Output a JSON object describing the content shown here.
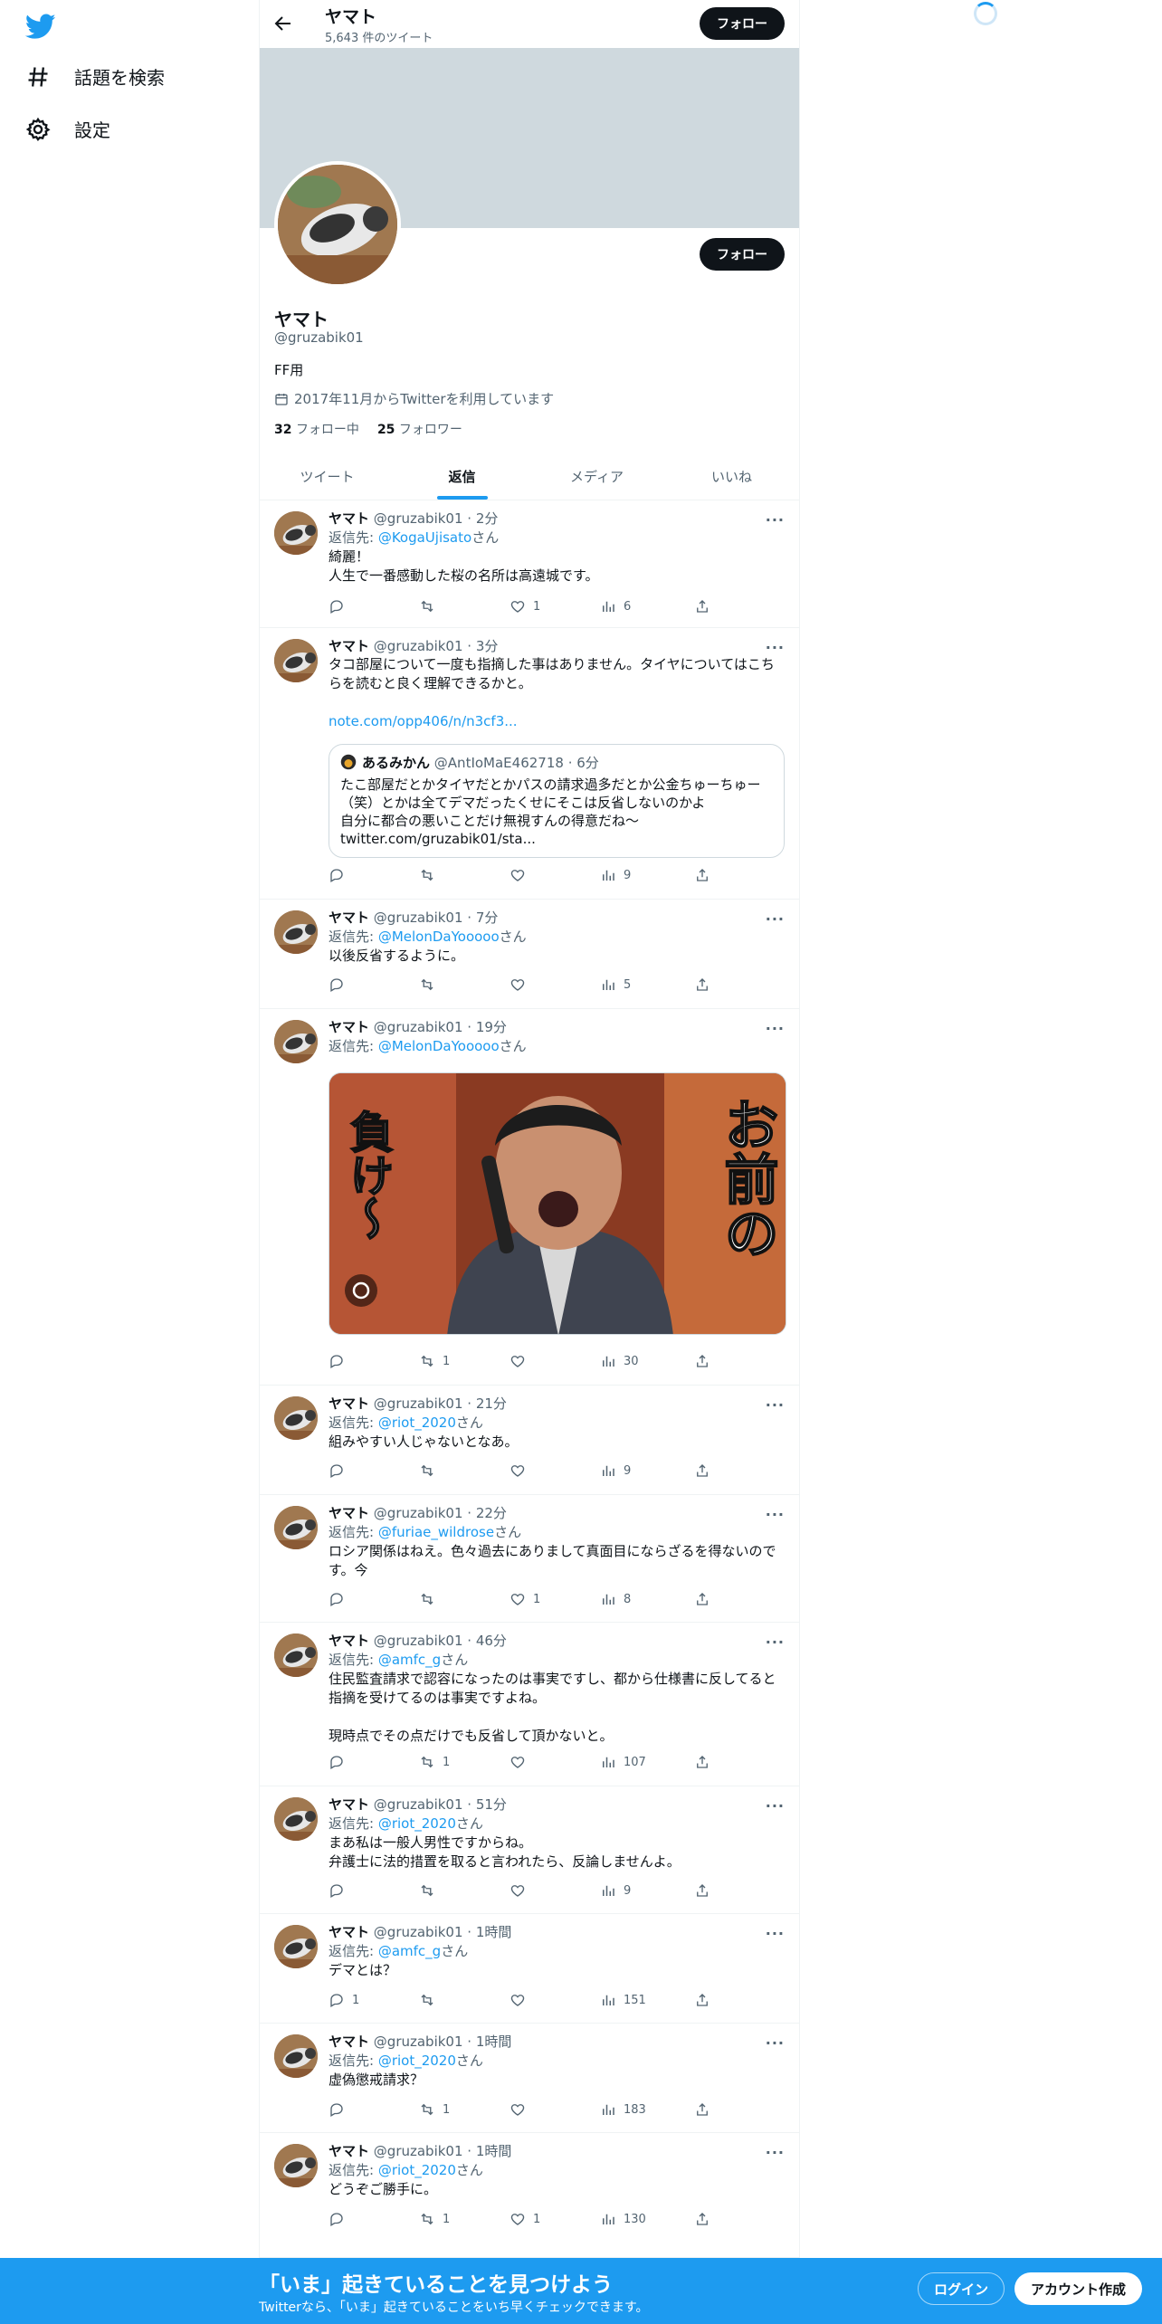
{
  "nav": {
    "explore_label": "話題を検索",
    "settings_label": "設定"
  },
  "header": {
    "name": "ヤマト",
    "tweet_count": "5,643 件のツイート",
    "follow_label": "フォロー"
  },
  "profile": {
    "name": "ヤマト",
    "handle": "@gruzabik01",
    "bio": "FF用",
    "joined": "2017年11月からTwitterを利用しています",
    "following_count": "32",
    "following_label": "フォロー中",
    "followers_count": "25",
    "followers_label": "フォロワー",
    "follow_label": "フォロー"
  },
  "tabs": [
    "ツイート",
    "返信",
    "メディア",
    "いいね"
  ],
  "reply_prefix": "返信先: ",
  "reply_suffix": "さん",
  "tweets": [
    {
      "name": "ヤマト",
      "meta": "@gruzabik01 · 2分",
      "reply_to": "@KogaUjisato",
      "text": "綺麗！\n人生で一番感動した桜の名所は高遠城です。",
      "replies": "",
      "retweets": "",
      "likes": "1",
      "views": "6"
    },
    {
      "name": "ヤマト",
      "meta": "@gruzabik01 · 3分",
      "text": "タコ部屋について一度も指摘した事はありません。タイヤについてはこちらを読むと良く理解できるかと。",
      "link": "note.com/opp406/n/n3cf3...",
      "quote": {
        "name": "あるみかん",
        "meta": "@AntIoMaE462718 · 6分",
        "text": "たこ部屋だとかタイヤだとかパスの請求過多だとか公金ちゅーちゅー（笑）とかは全てデマだったくせにそこは反省しないのかよ\n自分に都合の悪いことだけ無視すんの得意だね〜\ntwitter.com/gruzabik01/sta..."
      },
      "replies": "",
      "retweets": "",
      "likes": "",
      "views": "9"
    },
    {
      "name": "ヤマト",
      "meta": "@gruzabik01 · 7分",
      "reply_to": "@MelonDaYooooo",
      "text": "以後反省するように。",
      "replies": "",
      "retweets": "",
      "likes": "",
      "views": "5"
    },
    {
      "name": "ヤマト",
      "meta": "@gruzabik01 · 19分",
      "reply_to": "@MelonDaYooooo",
      "media_text_left": "負け〜",
      "media_text_right": "お前の",
      "replies": "",
      "retweets": "1",
      "likes": "",
      "views": "30"
    },
    {
      "name": "ヤマト",
      "meta": "@gruzabik01 · 21分",
      "reply_to": "@riot_2020",
      "text": "組みやすい人じゃないとなあ。",
      "replies": "",
      "retweets": "",
      "likes": "",
      "views": "9"
    },
    {
      "name": "ヤマト",
      "meta": "@gruzabik01 · 22分",
      "reply_to": "@furiae_wildrose",
      "text": "ロシア関係はねえ。色々過去にありまして真面目にならざるを得ないのです。今",
      "replies": "",
      "retweets": "",
      "likes": "1",
      "views": "8"
    },
    {
      "name": "ヤマト",
      "meta": "@gruzabik01 · 46分",
      "reply_to": "@amfc_g",
      "text": "住民監査請求で認容になったのは事実ですし、都から仕様書に反してると指摘を受けてるのは事実ですよね。\n\n現時点でその点だけでも反省して頂かないと。",
      "replies": "",
      "retweets": "1",
      "likes": "",
      "views": "107"
    },
    {
      "name": "ヤマト",
      "meta": "@gruzabik01 · 51分",
      "reply_to": "@riot_2020",
      "text": "まあ私は一般人男性ですからね。\n弁護士に法的措置を取ると言われたら、反論しませんよ。",
      "replies": "",
      "retweets": "",
      "likes": "",
      "views": "9"
    },
    {
      "name": "ヤマト",
      "meta": "@gruzabik01 · 1時間",
      "reply_to": "@amfc_g",
      "text": "デマとは？",
      "replies": "1",
      "retweets": "",
      "likes": "",
      "views": "151"
    },
    {
      "name": "ヤマト",
      "meta": "@gruzabik01 · 1時間",
      "reply_to": "@riot_2020",
      "text": "虚偽懲戒請求？",
      "replies": "",
      "retweets": "1",
      "likes": "",
      "views": "183"
    },
    {
      "name": "ヤマト",
      "meta": "@gruzabik01 · 1時間",
      "reply_to": "@riot_2020",
      "text": "どうぞご勝手に。",
      "replies": "",
      "retweets": "1",
      "likes": "1",
      "views": "130"
    }
  ],
  "bottom_bar": {
    "title": "「いま」起きていることを見つけよう",
    "subtitle": "Twitterなら、「いま」起きていることをいち早くチェックできます。",
    "login_label": "ログイン",
    "signup_label": "アカウント作成"
  },
  "colors": {
    "accent": "#1d9bf0",
    "text": "#0f1419",
    "muted": "#536471",
    "banner": "#cfd9de"
  }
}
